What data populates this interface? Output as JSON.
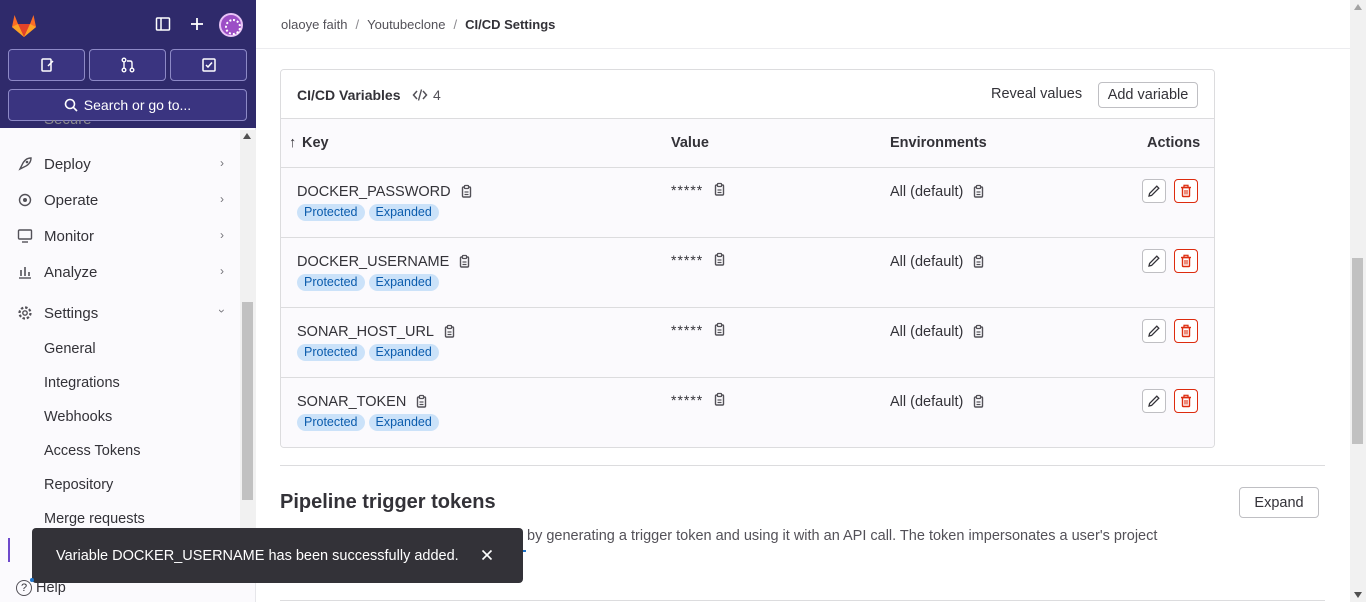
{
  "sidebar": {
    "search_label": "Search or go to...",
    "partial_top_item": "Secure",
    "nav": [
      {
        "label": "Deploy",
        "icon": "rocket-icon"
      },
      {
        "label": "Operate",
        "icon": "cloud-gear-icon"
      },
      {
        "label": "Monitor",
        "icon": "monitor-icon"
      },
      {
        "label": "Analyze",
        "icon": "chart-icon"
      },
      {
        "label": "Settings",
        "icon": "gear-icon"
      }
    ],
    "settings_sub": [
      "General",
      "Integrations",
      "Webhooks",
      "Access Tokens",
      "Repository",
      "Merge requests"
    ],
    "help_label": "Help"
  },
  "breadcrumb": {
    "user": "olaoye faith",
    "project": "Youtubeclone",
    "current": "CI/CD Settings"
  },
  "variables_card": {
    "title": "CI/CD Variables",
    "count": "4",
    "reveal_label": "Reveal values",
    "add_label": "Add variable",
    "columns": {
      "key": "Key",
      "value": "Value",
      "environments": "Environments",
      "actions": "Actions"
    },
    "rows": [
      {
        "key": "DOCKER_PASSWORD",
        "value": "*****",
        "env": "All (default)",
        "badges": [
          "Protected",
          "Expanded"
        ]
      },
      {
        "key": "DOCKER_USERNAME",
        "value": "*****",
        "env": "All (default)",
        "badges": [
          "Protected",
          "Expanded"
        ]
      },
      {
        "key": "SONAR_HOST_URL",
        "value": "*****",
        "env": "All (default)",
        "badges": [
          "Protected",
          "Expanded"
        ]
      },
      {
        "key": "SONAR_TOKEN",
        "value": "*****",
        "env": "All (default)",
        "badges": [
          "Protected",
          "Expanded"
        ]
      }
    ]
  },
  "trigger_section": {
    "title": "Pipeline trigger tokens",
    "expand_label": "Expand",
    "description": "by generating a trigger token and using it with an API call. The token impersonates a user's project"
  },
  "toast": {
    "message": "Variable DOCKER_USERNAME has been successfully added."
  },
  "colors": {
    "sidebar_top": "#2f2a6b",
    "badge_bg": "#cbe2f9",
    "badge_text": "#0b5cad",
    "danger": "#dd2b0e",
    "toast_bg": "#333238"
  }
}
